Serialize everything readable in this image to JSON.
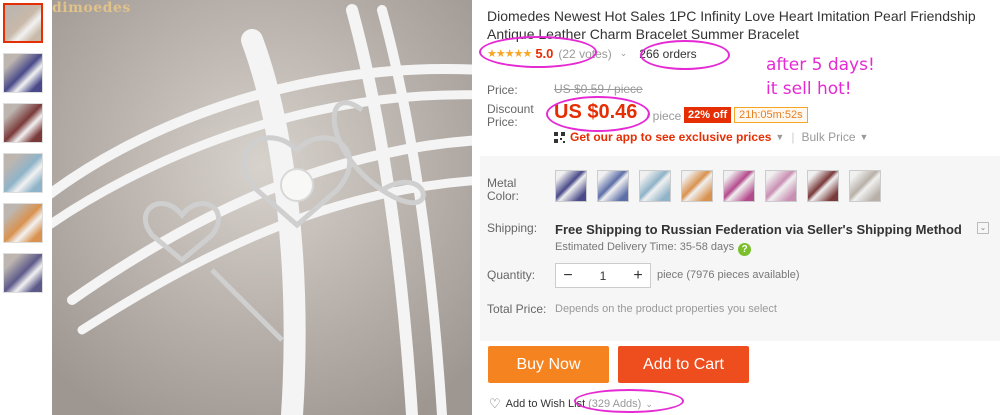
{
  "brand_watermark": "dimoedes",
  "product": {
    "title": "Diomedes Newest Hot Sales 1PC Infinity Love Heart Imitation Pearl Friendship Antique Leather Charm Bracelet Summer Bracelet",
    "stars": "★★★★★",
    "rating": "5.0",
    "votes": "(22 votes)",
    "orders": "266 orders"
  },
  "price": {
    "label": "Price:",
    "original": "US $0.59 / piece",
    "discount_label": "Discount Price:",
    "discount": "US $0.46",
    "per_piece": "/ piece",
    "off_badge": "22% off",
    "timer": "21h:05m:52s"
  },
  "app_promo": {
    "text": "Get our app to see exclusive prices",
    "bulk": "Bulk Price"
  },
  "metal_color": {
    "label": "Metal Color:",
    "swatch_colors": [
      "#4a4a8a",
      "#5d6fa8",
      "#8fb3c8",
      "#d9924f",
      "#b44a8c",
      "#c98fb3",
      "#7a3a3a",
      "#b8b0a8"
    ]
  },
  "shipping": {
    "label": "Shipping:",
    "method": "Free Shipping to Russian Federation via Seller's Shipping Method",
    "estimate": "Estimated Delivery Time: 35-58 days",
    "help": "?"
  },
  "quantity": {
    "label": "Quantity:",
    "minus": "−",
    "value": "1",
    "plus": "+",
    "available": "piece (7976 pieces available)"
  },
  "total": {
    "label": "Total Price:",
    "value": "Depends on the product properties you select"
  },
  "actions": {
    "buy_now": "Buy Now",
    "add_to_cart": "Add to Cart"
  },
  "wishlist": {
    "label": "Add to Wish List",
    "count": "(329 Adds)"
  },
  "annotation": {
    "line1": "after 5 days!",
    "line2": "it sell hot!"
  },
  "thumbnail_colors": [
    "#c9b9a8",
    "#4a4a8a",
    "#7a3a3a",
    "#8fb3c8",
    "#d9924f",
    "#5d5a8a"
  ]
}
